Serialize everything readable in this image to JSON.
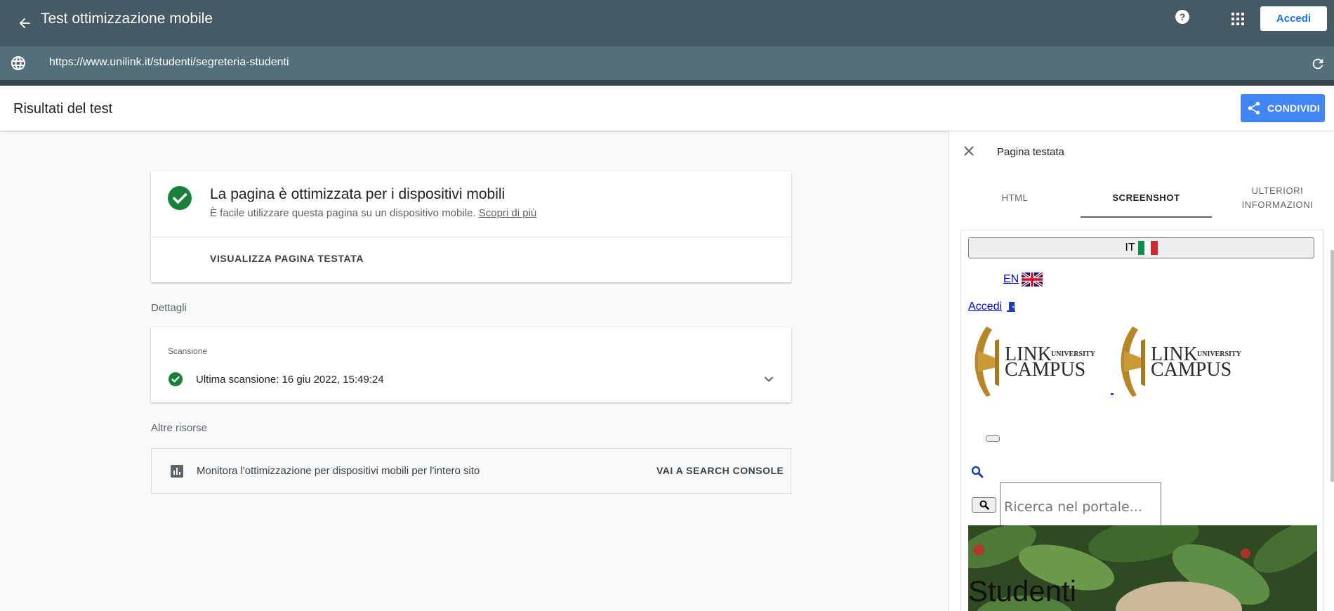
{
  "topbar": {
    "title": "Test ottimizzazione mobile",
    "signin_label": "Accedi"
  },
  "urlbar": {
    "url": "https://www.unilink.it/studenti/segreteria-studenti"
  },
  "results": {
    "title": "Risultati del test",
    "share_label": "CONDIVIDI"
  },
  "main_card": {
    "headline": "La pagina è ottimizzata per i dispositivi mobili",
    "subline": "È facile utilizzare questa pagina su un dispositivo mobile.",
    "learn_more": "Scopri di più",
    "view_button": "VISUALIZZA PAGINA TESTATA"
  },
  "details": {
    "label": "Dettagli",
    "scan_label": "Scansione",
    "last_scan": "Ultima scansione: 16 giu 2022, 15:49:24"
  },
  "resources": {
    "label": "Altre risorse",
    "monitor_text": "Monitora l'ottimizzazione per dispositivi mobili per l'intero sito",
    "console_button": "VAI A SEARCH CONSOLE"
  },
  "panel": {
    "title": "Pagina testata",
    "tabs": [
      {
        "label": "HTML",
        "active": false
      },
      {
        "label": "SCREENSHOT",
        "active": true
      },
      {
        "label": "ULTERIORI INFORMAZIONI",
        "active": false
      }
    ]
  },
  "screenshot": {
    "lang_it": "IT",
    "lang_en": "EN",
    "login": "Accedi",
    "logo_text_1": "LINK",
    "logo_text_2": "UNIVERSITY",
    "logo_text_3": "CAMPUS",
    "search_placeholder": "Ricerca nel portale...",
    "hero_text": "Studenti"
  },
  "colors": {
    "topbar": "#455a64",
    "urlbar": "#546e7a",
    "accent": "#4285f4",
    "success": "#188038"
  }
}
